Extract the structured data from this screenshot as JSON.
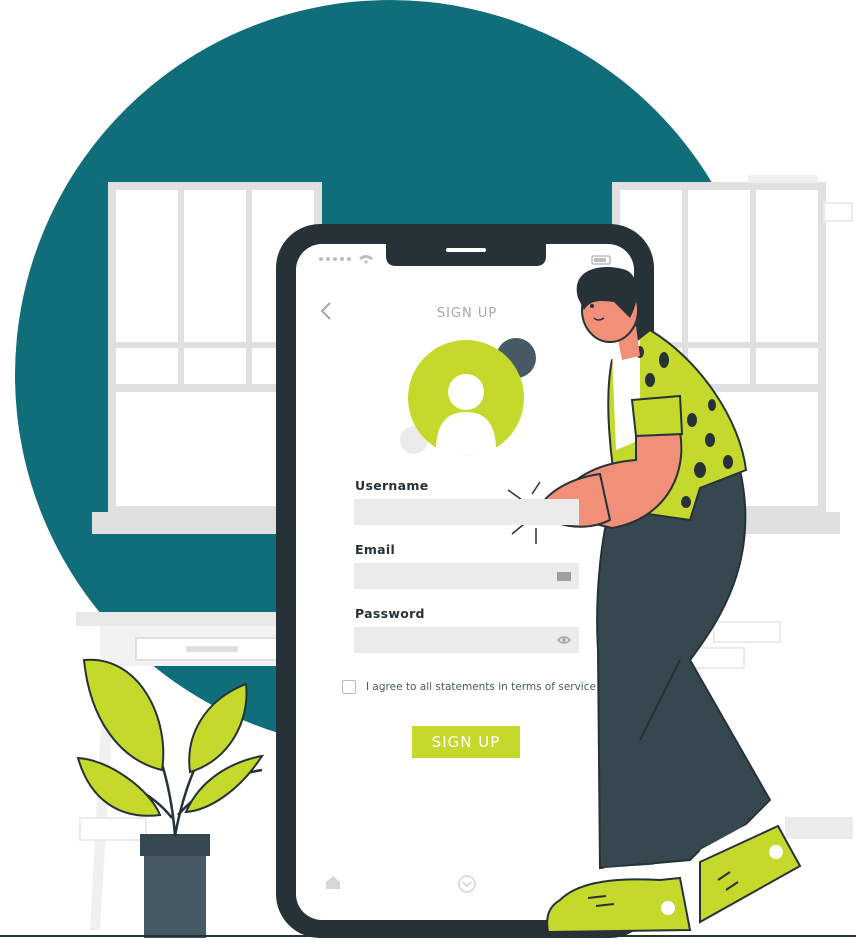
{
  "screen": {
    "title": "SIGN UP",
    "back_icon": "chevron-left-icon",
    "avatar_icon": "user-avatar-icon"
  },
  "form": {
    "username_label": "Username",
    "username_value": "",
    "email_label": "Email",
    "email_value": "",
    "email_icon": "envelope-icon",
    "password_label": "Password",
    "password_value": "",
    "password_icon": "eye-icon",
    "agree_text": "I agree to all statements in terms of service",
    "agree_checked": false,
    "submit_label": "SIGN UP"
  },
  "bottom_nav": {
    "home_icon": "home-icon",
    "middle_icon": "chevron-circle-icon"
  },
  "colors": {
    "teal": "#0f6e7a",
    "accent_green": "#c5d92d",
    "dark": "#263238",
    "field_gray": "#ebebeb"
  }
}
